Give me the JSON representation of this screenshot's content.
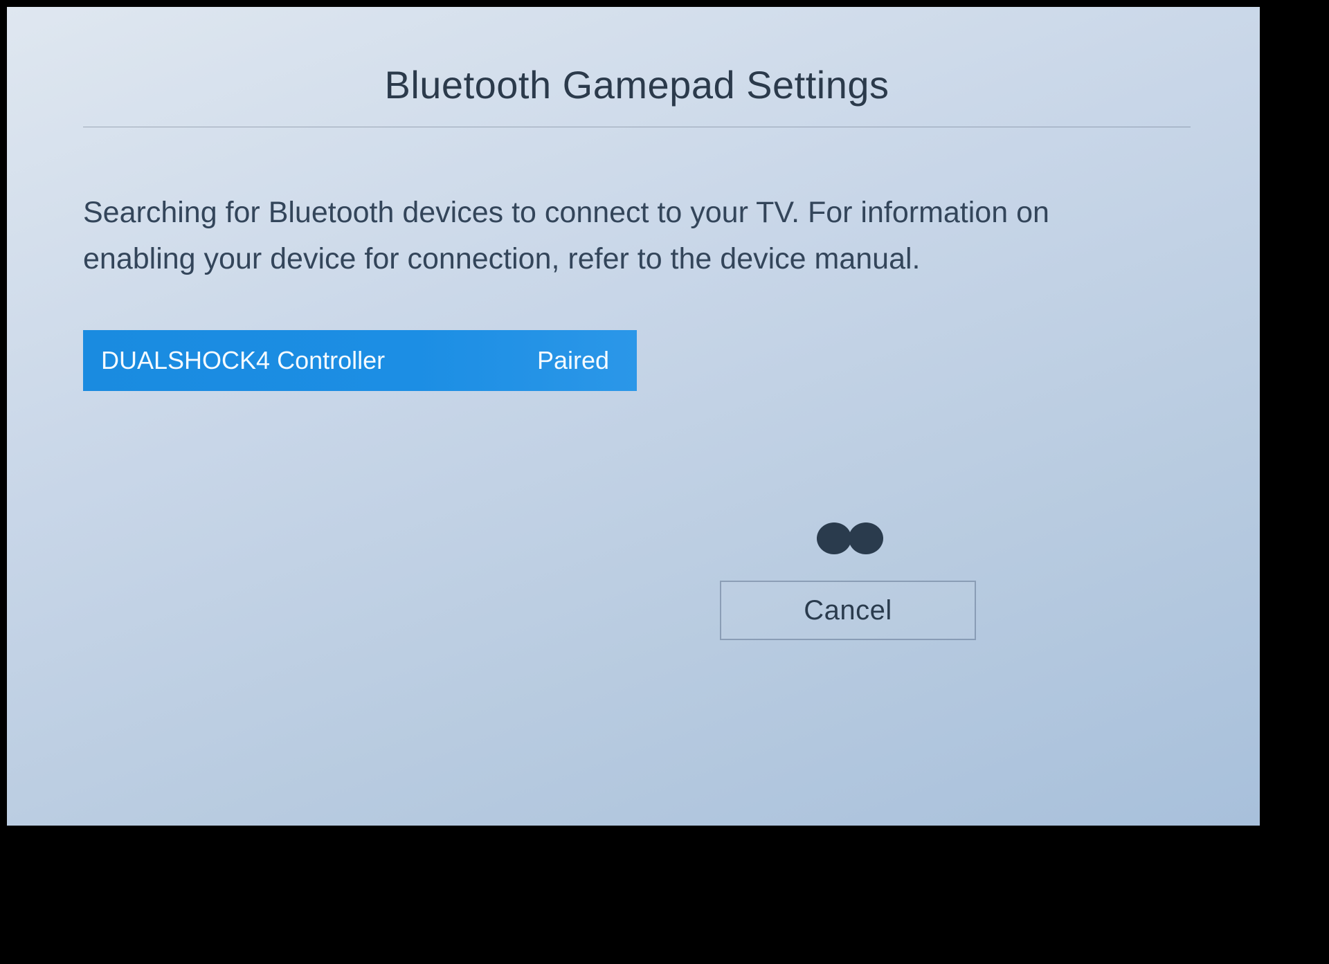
{
  "title": "Bluetooth Gamepad Settings",
  "description": "Searching for Bluetooth devices to connect to your TV. For information on enabling your device for connection, refer to the device manual.",
  "devices": [
    {
      "name": "DUALSHOCK4 Controller",
      "status": "Paired"
    }
  ],
  "cancel_label": "Cancel"
}
